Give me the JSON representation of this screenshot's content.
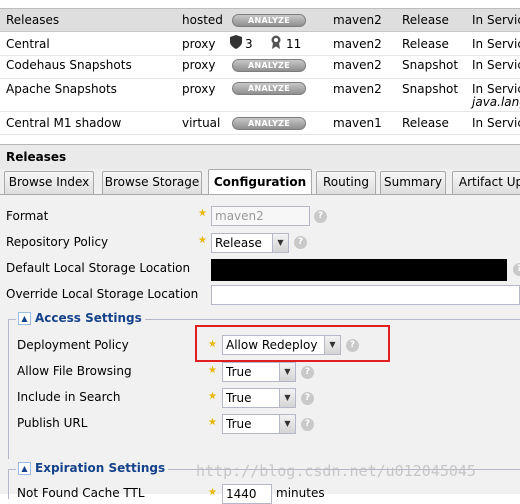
{
  "grid": {
    "rows": [
      {
        "name": "Releases",
        "type": "hosted",
        "analyze": "ANALYZE",
        "format": "maven2",
        "policy": "Release",
        "status": "In Service",
        "selected": true
      },
      {
        "name": "Central",
        "type": "proxy",
        "shield_count": "3",
        "award_count": "11",
        "format": "maven2",
        "policy": "Release",
        "status": "In Service"
      },
      {
        "name": "Codehaus Snapshots",
        "type": "proxy",
        "analyze": "ANALYZE",
        "format": "maven2",
        "policy": "Snapshot",
        "status": "In Service"
      },
      {
        "name": "Apache Snapshots",
        "type": "proxy",
        "analyze": "ANALYZE",
        "format": "maven2",
        "policy": "Snapshot",
        "status": "In Service",
        "sub": "java.lang"
      },
      {
        "name": "Central M1 shadow",
        "type": "virtual",
        "analyze": "ANALYZE",
        "format": "maven1",
        "policy": "Release",
        "status": "In Service"
      }
    ]
  },
  "panel": {
    "title": "Releases",
    "tabs": [
      "Browse Index",
      "Browse Storage",
      "Configuration",
      "Routing",
      "Summary",
      "Artifact Up"
    ]
  },
  "form": {
    "format_label": "Format",
    "format_value": "maven2",
    "repo_policy_label": "Repository Policy",
    "repo_policy_value": "Release",
    "default_storage_label": "Default Local Storage Location",
    "override_storage_label": "Override Local Storage Location",
    "access_settings": {
      "legend": "Access Settings",
      "deployment_policy_label": "Deployment Policy",
      "deployment_policy_value": "Allow Redeploy",
      "allow_browsing_label": "Allow File Browsing",
      "allow_browsing_value": "True",
      "include_search_label": "Include in Search",
      "include_search_value": "True",
      "publish_url_label": "Publish URL",
      "publish_url_value": "True"
    },
    "expiration_settings": {
      "legend": "Expiration Settings",
      "not_found_label": "Not Found Cache TTL",
      "not_found_value": "1440",
      "not_found_unit": "minutes"
    }
  },
  "watermark": "http://blog.csdn.net/u012045045",
  "colors": {
    "highlight": "#e02020",
    "star": "#e8b800",
    "legend": "#15428b"
  }
}
